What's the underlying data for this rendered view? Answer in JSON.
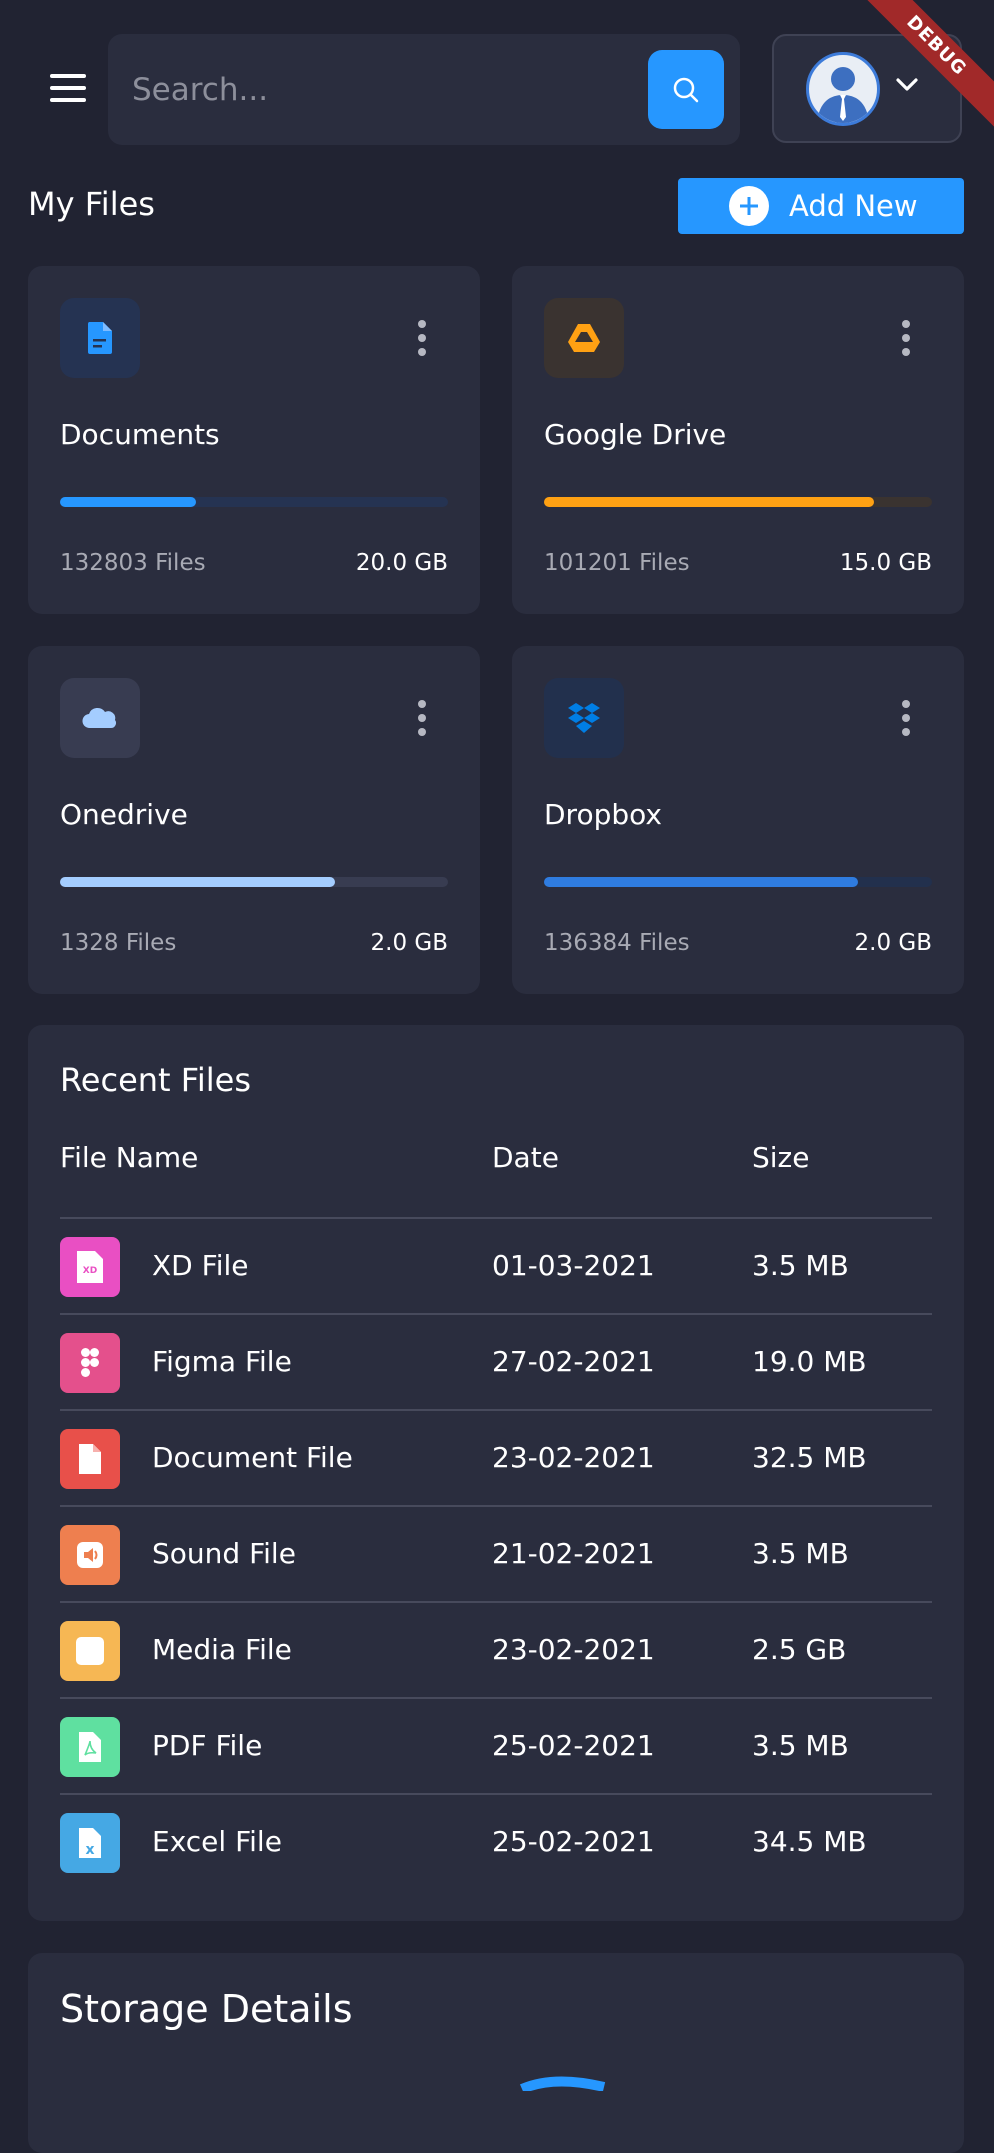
{
  "header": {
    "search_placeholder": "Search...",
    "debug_banner": "DEBUG"
  },
  "page": {
    "title": "My Files",
    "add_button_label": "Add New"
  },
  "storage_cards": [
    {
      "name": "Documents",
      "files": "132803 Files",
      "size": "20.0 GB",
      "usage_percent": 35,
      "color": "#2697ff",
      "icon": "document-icon"
    },
    {
      "name": "Google Drive",
      "files": "101201 Files",
      "size": "15.0 GB",
      "usage_percent": 85,
      "color": "#ffa113",
      "icon": "google-drive-icon"
    },
    {
      "name": "Onedrive",
      "files": "1328 Files",
      "size": "2.0 GB",
      "usage_percent": 71,
      "color": "#a4cdff",
      "icon": "cloud-icon"
    },
    {
      "name": "Dropbox",
      "files": "136384 Files",
      "size": "2.0 GB",
      "usage_percent": 81,
      "color": "#007ee5",
      "icon": "dropbox-icon"
    }
  ],
  "recent_files": {
    "title": "Recent Files",
    "columns": [
      "File Name",
      "Date",
      "Size"
    ],
    "rows": [
      {
        "name": "XD File",
        "date": "01-03-2021",
        "size": "3.5 MB",
        "icon": "xd-file-icon",
        "color": "#e94fc3"
      },
      {
        "name": "Figma File",
        "date": "27-02-2021",
        "size": "19.0 MB",
        "icon": "figma-file-icon",
        "color": "#e4508c"
      },
      {
        "name": "Document File",
        "date": "23-02-2021",
        "size": "32.5 MB",
        "icon": "document-file-icon",
        "color": "#e8504a"
      },
      {
        "name": "Sound File",
        "date": "21-02-2021",
        "size": "3.5 MB",
        "icon": "sound-file-icon",
        "color": "#ee7f4f"
      },
      {
        "name": "Media File",
        "date": "23-02-2021",
        "size": "2.5 GB",
        "icon": "media-file-icon",
        "color": "#f6b754"
      },
      {
        "name": "PDF File",
        "date": "25-02-2021",
        "size": "3.5 MB",
        "icon": "pdf-file-icon",
        "color": "#5fe0a0"
      },
      {
        "name": "Excel File",
        "date": "25-02-2021",
        "size": "34.5 MB",
        "icon": "excel-file-icon",
        "color": "#45a8e4"
      }
    ]
  },
  "storage_details": {
    "title": "Storage Details"
  }
}
